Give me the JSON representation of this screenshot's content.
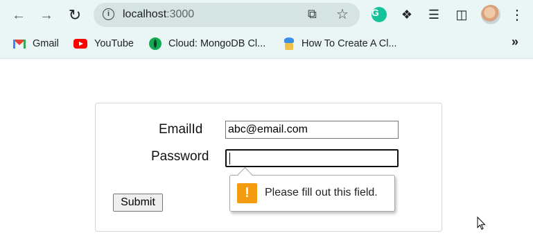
{
  "browser": {
    "url_host": "localhost",
    "url_port": ":3000",
    "bookmarks": [
      {
        "label": "Gmail",
        "icon": "gmail-icon"
      },
      {
        "label": "YouTube",
        "icon": "youtube-icon"
      },
      {
        "label": "Cloud: MongoDB Cl...",
        "icon": "mongodb-icon"
      },
      {
        "label": "How To Create A Cl...",
        "icon": "site-favicon-icon"
      }
    ],
    "more_label": "»"
  },
  "form": {
    "email_label": "EmailId",
    "email_value": "abc@email.com",
    "password_label": "Password",
    "password_value": "",
    "submit_label": "Submit",
    "validation_message": "Please fill out this field.",
    "warning_glyph": "!"
  },
  "colors": {
    "browser_chrome": "#eaf6f6",
    "warning": "#f39c12"
  }
}
